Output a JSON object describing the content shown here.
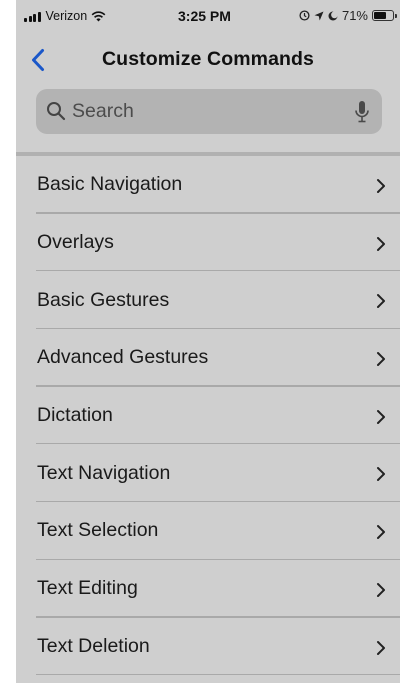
{
  "status_bar": {
    "carrier": "Verizon",
    "time": "3:25 PM",
    "battery_percent": "71%",
    "battery_level": 0.71,
    "icons": [
      "signal-bars-icon",
      "wifi-icon",
      "location-icon",
      "alarm-icon",
      "battery-icon"
    ]
  },
  "nav": {
    "title": "Customize Commands",
    "back_icon": "chevron-left-icon",
    "accent_color": "#1a57c9"
  },
  "search": {
    "placeholder": "Search",
    "value": "",
    "icons": [
      "search-icon",
      "mic-icon"
    ]
  },
  "commands": {
    "items": [
      {
        "label": "Basic Navigation"
      },
      {
        "label": "Overlays"
      },
      {
        "label": "Basic Gestures"
      },
      {
        "label": "Advanced Gestures"
      },
      {
        "label": "Dictation"
      },
      {
        "label": "Text Navigation"
      },
      {
        "label": "Text Selection"
      },
      {
        "label": "Text Editing"
      },
      {
        "label": "Text Deletion"
      }
    ],
    "row_icon": "chevron-right-icon"
  }
}
